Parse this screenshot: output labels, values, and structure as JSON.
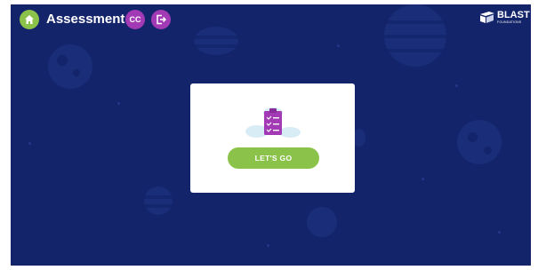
{
  "header": {
    "title": "Assessment",
    "user_initials": "CC",
    "home_icon": "home-icon",
    "logout_icon": "logout-icon"
  },
  "brand": {
    "name": "BLAST",
    "tagline": "FOUNDATIONS",
    "logo_icon": "blast-logo-icon"
  },
  "card": {
    "illustration_icon": "clipboard-checklist-icon",
    "button_label": "LET'S GO"
  },
  "colors": {
    "background": "#13246a",
    "accent_green": "#8bc34a",
    "accent_purple": "#a23ab5",
    "card": "#ffffff"
  }
}
